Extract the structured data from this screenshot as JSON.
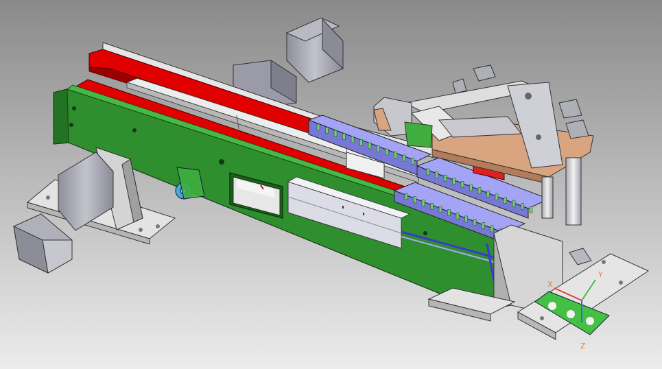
{
  "viewport": {
    "background_top": "#8a8a8a",
    "background_bottom": "#e9e9e9"
  },
  "colors": {
    "belt": "#e00000",
    "belt_dark": "#a50000",
    "frame": "#2f8f2f",
    "frame_dark": "#1f6b1f",
    "frame_light": "#3fae3f",
    "carrier": "#8e8ff0",
    "carrier_dark": "#6365cf",
    "carrier_slot": "#6ed06e",
    "plate": "#d9a581",
    "metal": "#c9c9cf",
    "metal_dark": "#8f8f96",
    "motor": "#a8a8b4",
    "motor_dark": "#7e7e8a",
    "base": "#dcdcdc"
  },
  "triad": {
    "x_label": "X",
    "y_label": "Y",
    "z_label": "Z",
    "x_color": "#e04040",
    "y_color": "#40c040",
    "z_color": "#4060e0"
  }
}
